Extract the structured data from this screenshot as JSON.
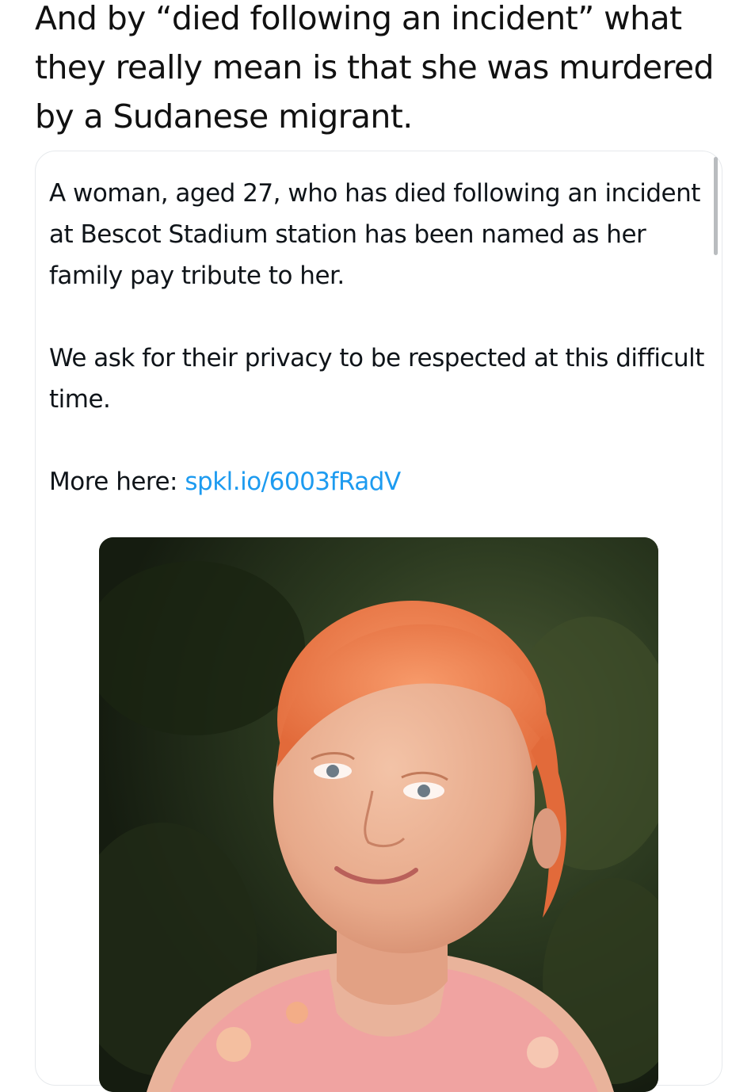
{
  "post": {
    "text": "And by “died following an incident” what they really mean is that she was murdered by a Sudanese migrant."
  },
  "quoted_post": {
    "paragraph_1": "A woman, aged 27, who has died following an incident at Bescot Stadium station has been named as her family pay tribute to her.",
    "paragraph_2": "We ask for their privacy to be respected at this difficult time.",
    "more_label": "More here: ",
    "link_text": "spkl.io/6003fRadV",
    "link_color": "#1d9bf0"
  },
  "photo": {
    "subject": "portrait-photo"
  }
}
